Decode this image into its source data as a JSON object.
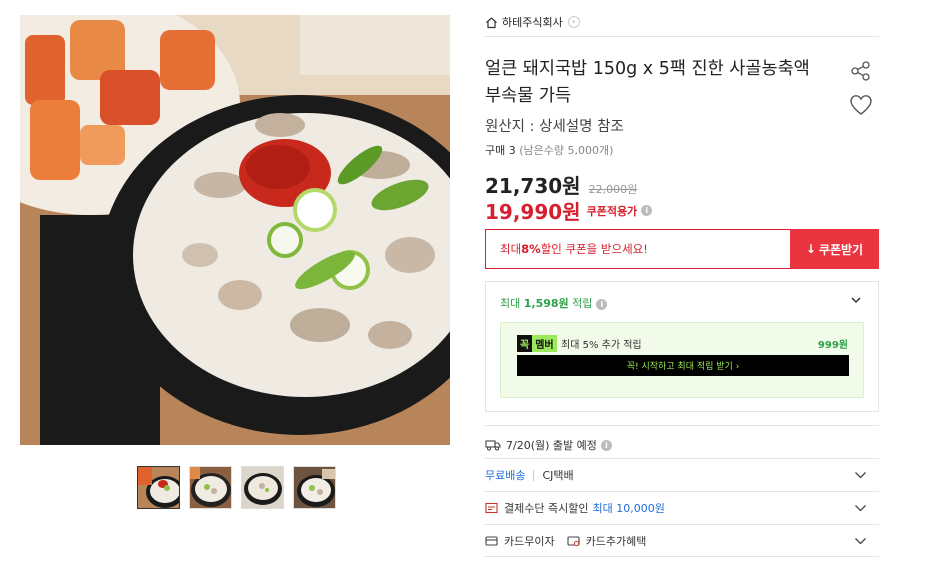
{
  "seller": {
    "name": "하테주식회사"
  },
  "product": {
    "title": "얼큰 돼지국밥 150g x 5팩 진한 사골농축액 부속물 가득",
    "origin": "원산지 : 상세설명 참조",
    "purchase_count": "구매 3",
    "remaining": "(남은수량 5,000개)"
  },
  "price": {
    "current": "21,730원",
    "original": "22,000원",
    "coupon_price": "19,990원",
    "coupon_label": "쿠폰적용가"
  },
  "coupon": {
    "message_prefix": "최대 ",
    "message_bold": "8%",
    "message_suffix": " 할인 쿠폰을 받으세요!",
    "button_label": "쿠폰받기"
  },
  "reward": {
    "head_prefix": "최대 ",
    "head_amount": "1,598원",
    "head_suffix": " 적립",
    "member_tag_1": "꼭",
    "member_tag_2": "멤버",
    "member_text": "최대 5% 추가 적립",
    "member_points": "999원",
    "member_button": "꼭! 시작하고 최대 적립 받기 ›"
  },
  "shipping": {
    "departure": "7/20(월) 출발 예정"
  },
  "rows": {
    "delivery_free": "무료배송",
    "delivery_carrier": "CJ택배",
    "payment_label": "결제수단 즉시할인",
    "payment_amount": "최대 10,000원",
    "card_installment": "카드무이자",
    "card_benefit": "카드추가혜택"
  },
  "icons": [
    "home-icon",
    "chevron-right-icon",
    "share-icon",
    "heart-icon",
    "info-icon",
    "download-icon",
    "chevron-down-icon",
    "truck-icon",
    "payment-icon",
    "card-icon"
  ],
  "colors": {
    "accent_red": "#d7202f",
    "coupon_button": "#e8353f",
    "reward_green": "#2da14a",
    "member_green": "#9be85a",
    "link_blue": "#1f6ed4"
  }
}
